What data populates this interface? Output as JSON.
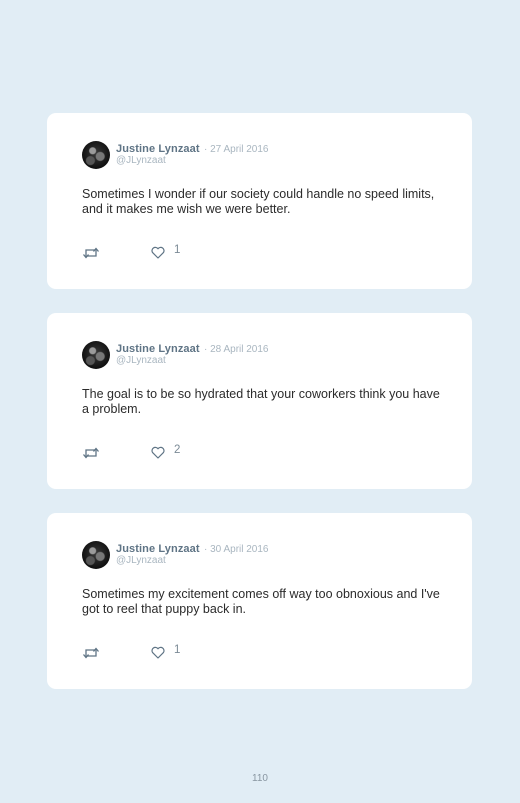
{
  "tweets": [
    {
      "name": "Justine Lynzaat",
      "date": "· 27 April 2016",
      "handle": "@JLynzaat",
      "text": "Sometimes I wonder if our society could handle no speed limits, and it makes me wish we were better.",
      "likes": "1"
    },
    {
      "name": "Justine Lynzaat",
      "date": "· 28 April 2016",
      "handle": "@JLynzaat",
      "text": "The goal is to be so hydrated that your coworkers think you have a problem.",
      "likes": "2"
    },
    {
      "name": "Justine Lynzaat",
      "date": "· 30 April 2016",
      "handle": "@JLynzaat",
      "text": "Sometimes my excitement comes off way too obnoxious and I've got to reel that puppy back in.",
      "likes": "1"
    }
  ],
  "page_number": "110",
  "colors": {
    "background": "#e1edf5",
    "card": "#ffffff",
    "name": "#5f7485",
    "meta": "#a9b6c0",
    "icon": "#5f7485"
  },
  "icons": {
    "retweet": "retweet-icon",
    "like": "heart-icon"
  }
}
